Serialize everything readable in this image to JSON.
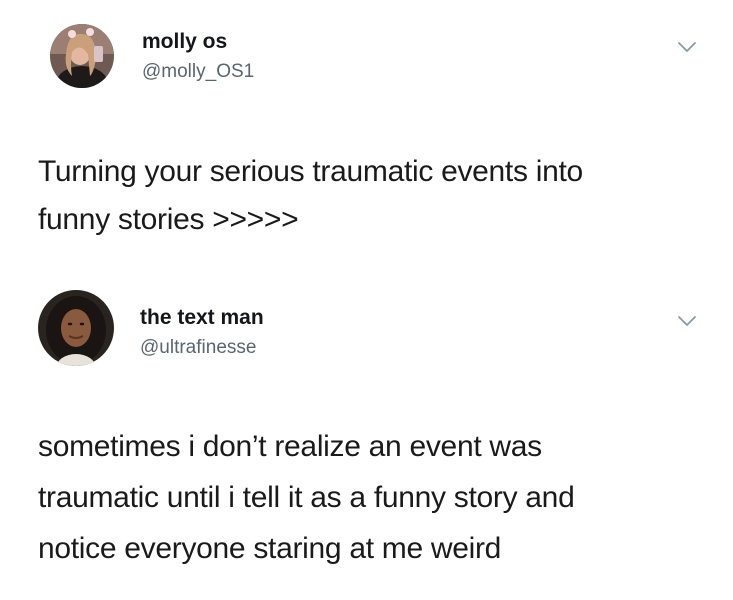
{
  "tweets": [
    {
      "display_name": "molly os",
      "handle": "@molly_OS1",
      "text_lines": [
        "Turning your serious traumatic events into",
        "funny stories >>>>>"
      ],
      "avatar_icon": "profile-photo-icon",
      "menu_icon": "chevron-down-icon"
    },
    {
      "display_name": "the text man",
      "handle": "@ultrafinesse",
      "text_lines": [
        "sometimes i don’t realize an event was",
        "traumatic until i tell it as a funny story and",
        "notice everyone staring at me weird"
      ],
      "avatar_icon": "profile-photo-icon",
      "menu_icon": "chevron-down-icon"
    }
  ],
  "colors": {
    "name": "#14171a",
    "handle": "#5a6570",
    "body": "#1a1a1a",
    "chevron": "#8899a6",
    "background": "#ffffff"
  }
}
